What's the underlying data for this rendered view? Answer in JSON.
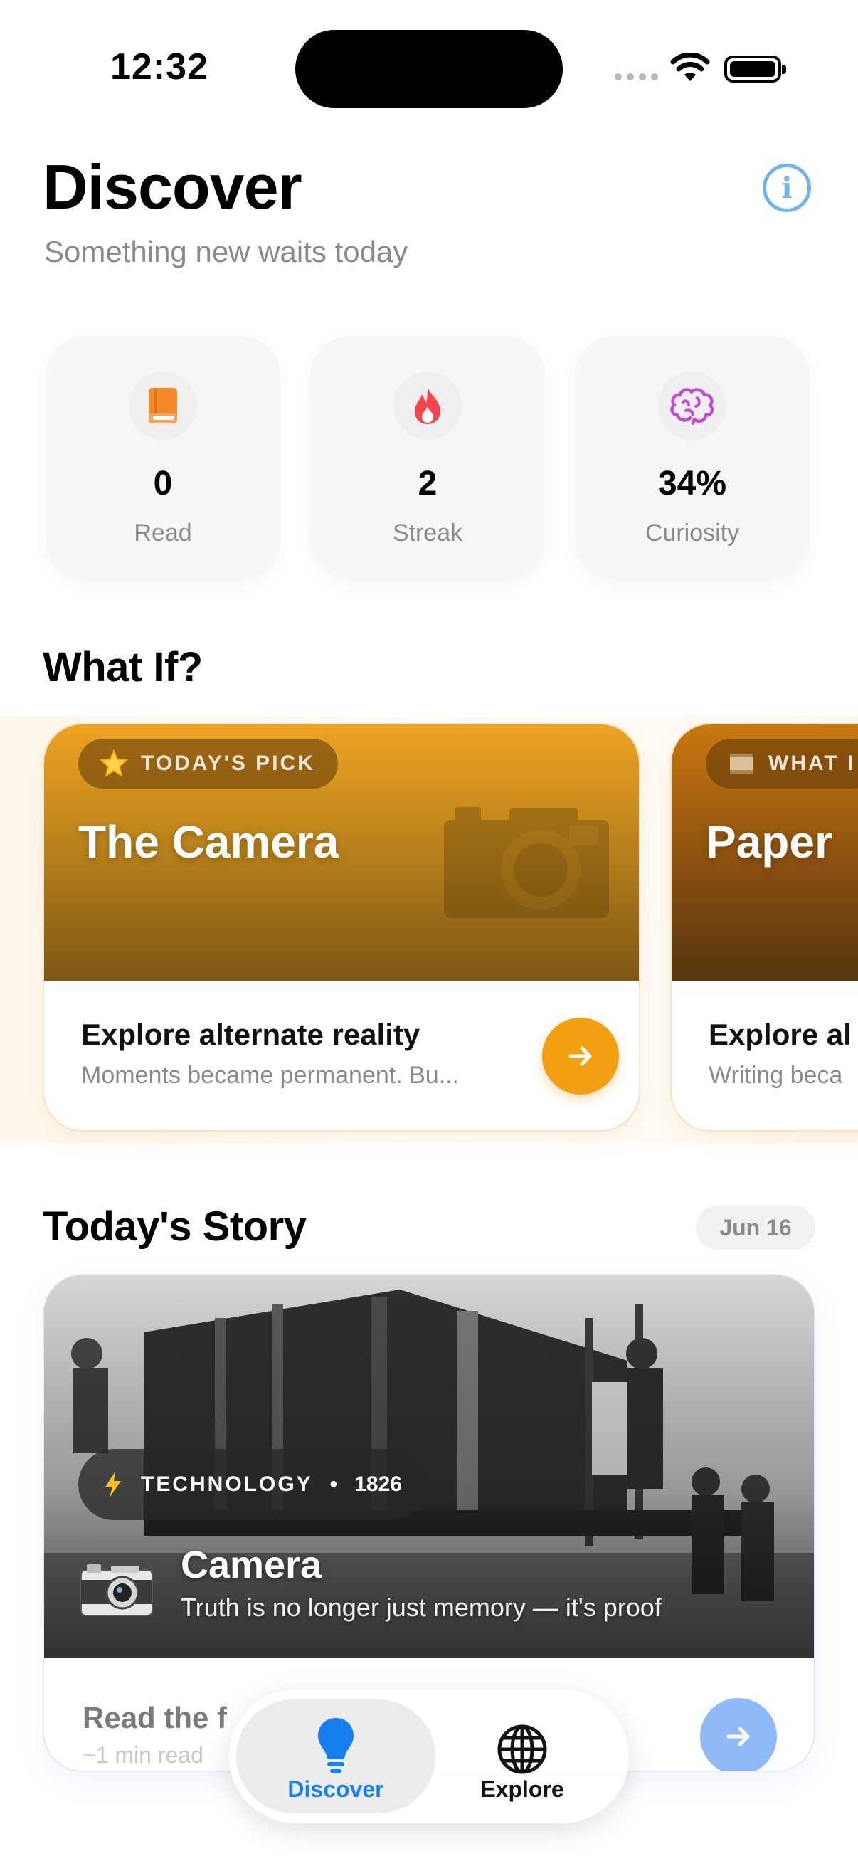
{
  "status_bar": {
    "time": "12:32"
  },
  "header": {
    "title": "Discover",
    "subtitle": "Something new waits today",
    "info_icon": "info-icon",
    "info_glyph": "i",
    "accent_color": "#6eb4f2"
  },
  "stats": [
    {
      "icon": "book-icon",
      "value": "0",
      "label": "Read",
      "color": "#f5892a"
    },
    {
      "icon": "flame-icon",
      "value": "2",
      "label": "Streak",
      "color": "#f2464b"
    },
    {
      "icon": "brain-icon",
      "value": "34%",
      "label": "Curiosity",
      "color": "#c44ad8"
    }
  ],
  "what_if": {
    "section_title": "What If?",
    "cards": [
      {
        "badge_icon": "star-icon",
        "badge_label": "TODAY'S PICK",
        "title": "The Camera",
        "hero_icon": "camera-icon",
        "body_title": "Explore alternate reality",
        "body_subtitle": "Moments became permanent. Bu...",
        "button_icon": "arrow-right-icon",
        "accent_color": "#f29f12"
      },
      {
        "badge_icon": "scroll-icon",
        "badge_label": "WHAT I",
        "title": "Paper",
        "body_title": "Explore al",
        "body_subtitle": "Writing beca"
      }
    ]
  },
  "story": {
    "section_title": "Today's Story",
    "date": "Jun 16",
    "category_icon": "lightning-icon",
    "category": "TECHNOLOGY",
    "separator": "•",
    "year": "1826",
    "title_icon": "camera-icon",
    "title": "Camera",
    "subtitle": "Truth is no longer just memory — it's proof",
    "read_label": "Read the f",
    "read_time": "~1 min read",
    "button_icon": "arrow-right-icon"
  },
  "tab_bar": {
    "tabs": [
      {
        "icon": "lightbulb-icon",
        "label": "Discover",
        "active": true
      },
      {
        "icon": "globe-icon",
        "label": "Explore",
        "active": false
      }
    ],
    "active_color": "#1680f2"
  }
}
